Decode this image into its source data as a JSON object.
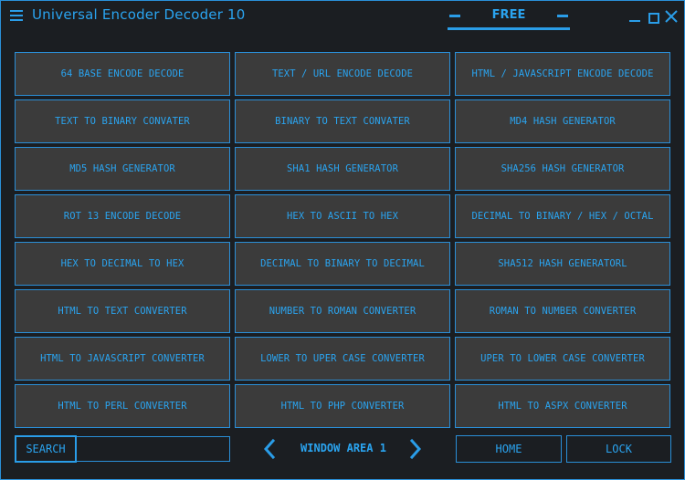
{
  "titlebar": {
    "title": "Universal Encoder Decoder 10",
    "menu_icon": "hamburger-icon",
    "badge": "FREE",
    "controls": [
      "minimize-icon",
      "maximize-icon",
      "close-icon"
    ]
  },
  "buttons": [
    "64 BASE ENCODE DECODE",
    "TEXT / URL ENCODE DECODE",
    "HTML / JAVASCRIPT ENCODE DECODE",
    "TEXT TO BINARY CONVATER",
    "BINARY TO TEXT CONVATER",
    "MD4 HASH GENERATOR",
    "MD5 HASH GENERATOR",
    "SHA1 HASH GENERATOR",
    "SHA256 HASH GENERATOR",
    "ROT 13 ENCODE DECODE",
    "HEX TO ASCII TO HEX",
    "DECIMAL TO BINARY / HEX / OCTAL",
    "HEX TO DECIMAL TO HEX",
    "DECIMAL TO BINARY TO DECIMAL",
    "SHA512 HASH GENERATORL",
    "HTML TO TEXT CONVERTER",
    "NUMBER TO ROMAN CONVERTER",
    "ROMAN TO NUMBER CONVERTER",
    "HTML TO JAVASCRIPT CONVERTER",
    "LOWER TO UPER CASE CONVERTER",
    "UPER TO LOWER CASE CONVERTER",
    "HTML TO PERL CONVERTER",
    "HTML TO PHP CONVERTER",
    "HTML TO ASPX CONVERTER"
  ],
  "bottom": {
    "search_label": "SEARCH",
    "search_value": "",
    "window_area": "WINDOW AREA 1",
    "home_label": "HOME",
    "lock_label": "LOCK"
  },
  "colors": {
    "accent": "#2aa4f0",
    "button_bg": "#3b3b3b",
    "window_bg": "#1b1e22"
  }
}
